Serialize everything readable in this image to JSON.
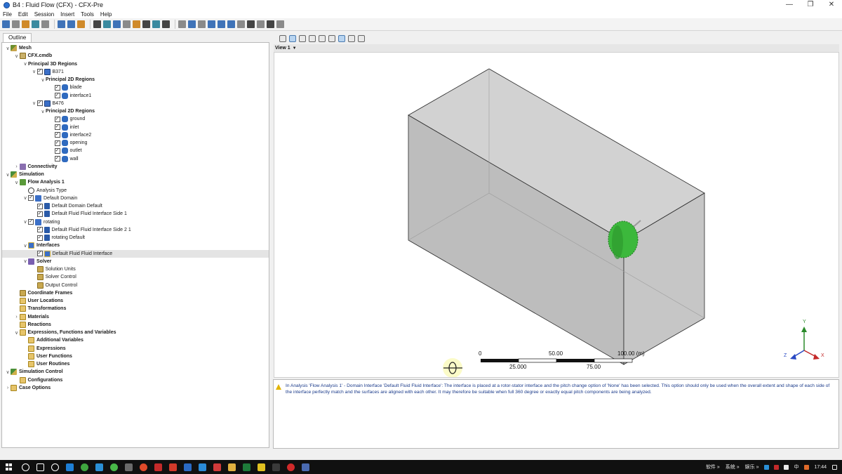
{
  "window": {
    "title": "B4 : Fluid Flow (CFX) - CFX-Pre",
    "controls": [
      "—",
      "❐",
      "✕"
    ]
  },
  "menu": [
    "File",
    "Edit",
    "Session",
    "Insert",
    "Tools",
    "Help"
  ],
  "outline": {
    "tab": "Outline",
    "tree": [
      {
        "label": "Mesh",
        "level": 0,
        "caret": "∨",
        "icon": "mesh",
        "bold": true,
        "check": false
      },
      {
        "label": "CFX.cmdb",
        "level": 1,
        "caret": "∨",
        "icon": "file",
        "bold": true,
        "check": false
      },
      {
        "label": "Principal 3D Regions",
        "level": 2,
        "caret": "∨",
        "icon": "",
        "bold": true,
        "check": false
      },
      {
        "label": "B371",
        "level": 3,
        "caret": "∨",
        "icon": "region",
        "bold": false,
        "check": true
      },
      {
        "label": "Principal 2D Regions",
        "level": 4,
        "caret": "∨",
        "icon": "",
        "bold": true,
        "check": false
      },
      {
        "label": "blade",
        "level": 5,
        "caret": "",
        "icon": "surf",
        "bold": false,
        "check": true
      },
      {
        "label": "interface1",
        "level": 5,
        "caret": "",
        "icon": "surf",
        "bold": false,
        "check": true
      },
      {
        "label": "B476",
        "level": 3,
        "caret": "∨",
        "icon": "region",
        "bold": false,
        "check": true
      },
      {
        "label": "Principal 2D Regions",
        "level": 4,
        "caret": "∨",
        "icon": "",
        "bold": true,
        "check": false
      },
      {
        "label": "ground",
        "level": 5,
        "caret": "",
        "icon": "surf",
        "bold": false,
        "check": true
      },
      {
        "label": "inlet",
        "level": 5,
        "caret": "",
        "icon": "surf",
        "bold": false,
        "check": true
      },
      {
        "label": "interface2",
        "level": 5,
        "caret": "",
        "icon": "surf",
        "bold": false,
        "check": true
      },
      {
        "label": "opening",
        "level": 5,
        "caret": "",
        "icon": "surf",
        "bold": false,
        "check": true
      },
      {
        "label": "outlet",
        "level": 5,
        "caret": "",
        "icon": "surf",
        "bold": false,
        "check": true
      },
      {
        "label": "wall",
        "level": 5,
        "caret": "",
        "icon": "surf",
        "bold": false,
        "check": true
      },
      {
        "label": "Connectivity",
        "level": 1,
        "caret": "›",
        "icon": "connect",
        "bold": true,
        "check": false
      },
      {
        "label": "Simulation",
        "level": 0,
        "caret": "∨",
        "icon": "sim",
        "bold": true,
        "check": false
      },
      {
        "label": "Flow Analysis 1",
        "level": 1,
        "caret": "∨",
        "icon": "flow",
        "bold": true,
        "check": false
      },
      {
        "label": "Analysis Type",
        "level": 2,
        "caret": "",
        "icon": "clock",
        "bold": false,
        "check": false
      },
      {
        "label": "Default Domain",
        "level": 2,
        "caret": "∨",
        "icon": "domain",
        "bold": false,
        "check": true
      },
      {
        "label": "Default Domain Default",
        "level": 3,
        "caret": "",
        "icon": "bc",
        "bold": false,
        "check": true
      },
      {
        "label": "Default Fluid Fluid Interface Side 1",
        "level": 3,
        "caret": "",
        "icon": "bc",
        "bold": false,
        "check": true
      },
      {
        "label": "rotating",
        "level": 2,
        "caret": "∨",
        "icon": "domain",
        "bold": false,
        "check": true
      },
      {
        "label": "Default Fluid Fluid Interface Side 2 1",
        "level": 3,
        "caret": "",
        "icon": "bc",
        "bold": false,
        "check": true
      },
      {
        "label": "rotating Default",
        "level": 3,
        "caret": "",
        "icon": "bc",
        "bold": false,
        "check": true
      },
      {
        "label": "Interfaces",
        "level": 2,
        "caret": "∨",
        "icon": "iface",
        "bold": true,
        "check": false
      },
      {
        "label": "Default Fluid Fluid Interface",
        "level": 3,
        "caret": "",
        "icon": "iface",
        "bold": false,
        "check": true,
        "selected": true
      },
      {
        "label": "Solver",
        "level": 2,
        "caret": "∨",
        "icon": "solver",
        "bold": true,
        "check": false
      },
      {
        "label": "Solution Units",
        "level": 3,
        "caret": "",
        "icon": "misc",
        "bold": false,
        "check": false
      },
      {
        "label": "Solver Control",
        "level": 3,
        "caret": "",
        "icon": "misc",
        "bold": false,
        "check": false
      },
      {
        "label": "Output Control",
        "level": 3,
        "caret": "",
        "icon": "misc",
        "bold": false,
        "check": false
      },
      {
        "label": "Coordinate Frames",
        "level": 1,
        "caret": "",
        "icon": "misc",
        "bold": true,
        "check": false
      },
      {
        "label": "User Locations",
        "level": 1,
        "caret": "",
        "icon": "folder",
        "bold": true,
        "check": false
      },
      {
        "label": "Transformations",
        "level": 1,
        "caret": "",
        "icon": "folder",
        "bold": true,
        "check": false
      },
      {
        "label": "Materials",
        "level": 1,
        "caret": "›",
        "icon": "folder",
        "bold": true,
        "check": false
      },
      {
        "label": "Reactions",
        "level": 1,
        "caret": "",
        "icon": "folder",
        "bold": true,
        "check": false
      },
      {
        "label": "Expressions, Functions and Variables",
        "level": 1,
        "caret": "∨",
        "icon": "folder",
        "bold": true,
        "check": false
      },
      {
        "label": "Additional Variables",
        "level": 2,
        "caret": "",
        "icon": "folder",
        "bold": true,
        "check": false
      },
      {
        "label": "Expressions",
        "level": 2,
        "caret": "",
        "icon": "folder",
        "bold": true,
        "check": false
      },
      {
        "label": "User Functions",
        "level": 2,
        "caret": "",
        "icon": "folder",
        "bold": true,
        "check": false
      },
      {
        "label": "User Routines",
        "level": 2,
        "caret": "",
        "icon": "folder",
        "bold": true,
        "check": false
      },
      {
        "label": "Simulation Control",
        "level": 0,
        "caret": "∨",
        "icon": "sim",
        "bold": true,
        "check": false
      },
      {
        "label": "Configurations",
        "level": 1,
        "caret": "",
        "icon": "folder",
        "bold": true,
        "check": false
      },
      {
        "label": "Case Options",
        "level": 0,
        "caret": "›",
        "icon": "folder",
        "bold": true,
        "check": false
      }
    ]
  },
  "viewer": {
    "view_label": "View 1",
    "scale": {
      "top_ticks": [
        "0",
        "50.00",
        "100.00  (m)"
      ],
      "bottom_ticks": [
        "25.000",
        "75.00"
      ]
    },
    "axes": {
      "x": "X",
      "y": "Y",
      "z": "Z"
    },
    "colors": {
      "domain_face": "#c8c8c8",
      "interface": "#3cb83c",
      "edge": "#2a2a2a"
    }
  },
  "messages": [
    {
      "level": "warning",
      "text": "In Analysis 'Flow Analysis 1' - Domain Interface 'Default Fluid Fluid Interface': The interface is placed at a rotor-stator interface and the pitch change option of 'None' has been selected. This option should only be used when the overall extent and shape of each side of the interface perfectly match and the surfaces are aligned with each other. It may therefore be suitable when full 360 degree or exactly equal pitch components are being analyzed."
    }
  ],
  "taskbar": {
    "tray_labels": [
      "软件 »",
      "系统 »",
      "娱乐 »",
      "中"
    ],
    "time": "17:44"
  }
}
